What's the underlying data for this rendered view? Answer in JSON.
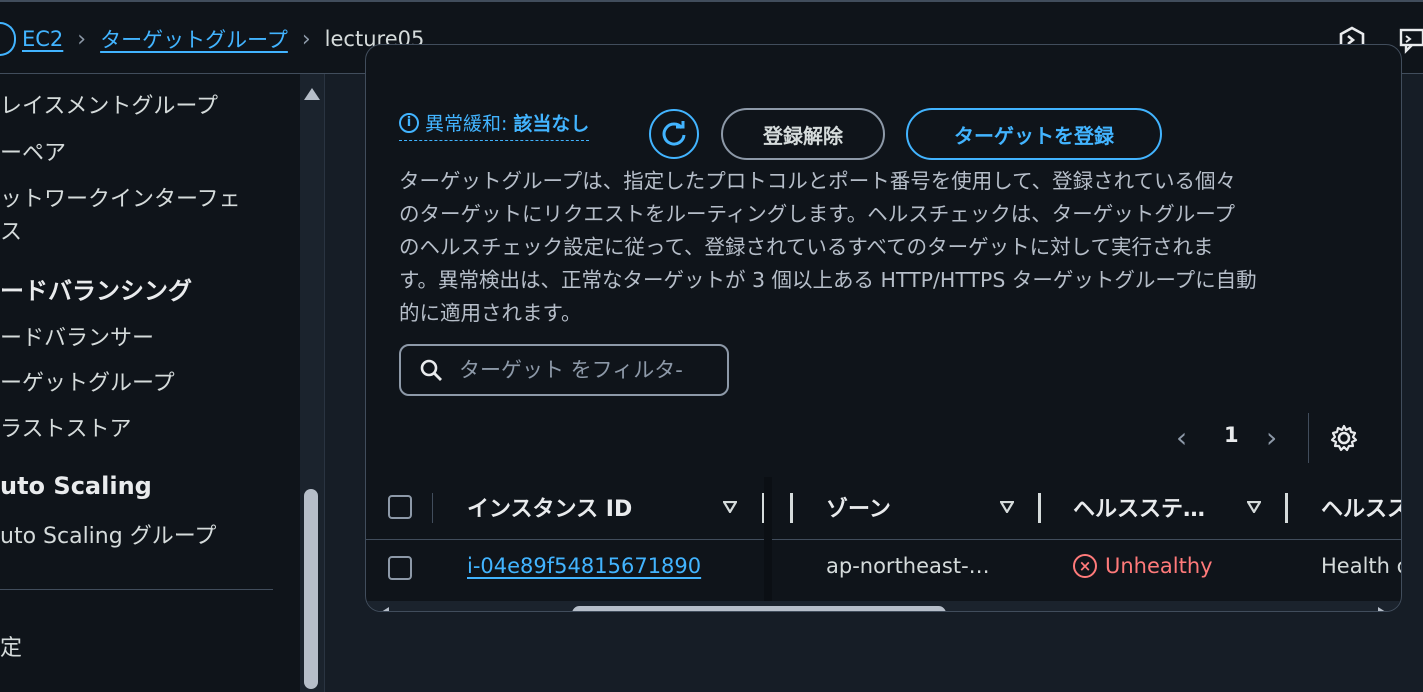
{
  "breadcrumb": {
    "items": [
      "EC2",
      "ターゲットグループ"
    ],
    "current": "lecture05",
    "separator": "›"
  },
  "header_icons": [
    "cloudshell-icon",
    "feedback-icon"
  ],
  "sidebar": {
    "items": [
      {
        "label": "レイスメントグループ",
        "type": "item"
      },
      {
        "label": "ーペア",
        "type": "item"
      },
      {
        "label": "ットワークインターフェ",
        "type": "item"
      },
      {
        "label": "ス",
        "type": "item"
      },
      {
        "label": "ードバランシング",
        "type": "heading"
      },
      {
        "label": "ードバランサー",
        "type": "item"
      },
      {
        "label": "ーゲットグループ",
        "type": "item"
      },
      {
        "label": "ラストストア",
        "type": "item"
      },
      {
        "label": "uto Scaling",
        "type": "heading"
      },
      {
        "label": "uto Scaling グループ",
        "type": "item"
      },
      {
        "label": "定",
        "type": "item"
      }
    ]
  },
  "panel": {
    "anomaly_label": "異常緩和:",
    "anomaly_value": "該当なし",
    "deregister_label": "登録解除",
    "register_label": "ターゲットを登録",
    "description_lines": [
      "ターゲットグループは、指定したプロトコルとポート番号を使用して、登録されている個々",
      "のターゲットにリクエストをルーティングします。ヘルスチェックは、ターゲットグループ",
      "のヘルスチェック設定に従って、登録されているすべてのターゲットに対して実行されま",
      "す。異常検出は、正常なターゲットが 3 個以上ある HTTP/HTTPS ターゲットグループに自動",
      "的に適用されます。"
    ],
    "search_placeholder": "ターゲット をフィルタ-",
    "page_number": "1"
  },
  "table": {
    "columns": [
      "インスタンス ID",
      "ゾーン",
      "ヘルスステ…",
      "ヘルスス"
    ],
    "rows": [
      {
        "instance_id": "i-04e89f54815671890",
        "zone": "ap-northeast-…",
        "health_status": "Unhealthy",
        "health_details": "Health c"
      }
    ]
  },
  "colors": {
    "link": "#42b4ff",
    "unhealthy": "#ff7a7a",
    "background": "#0f141a"
  }
}
